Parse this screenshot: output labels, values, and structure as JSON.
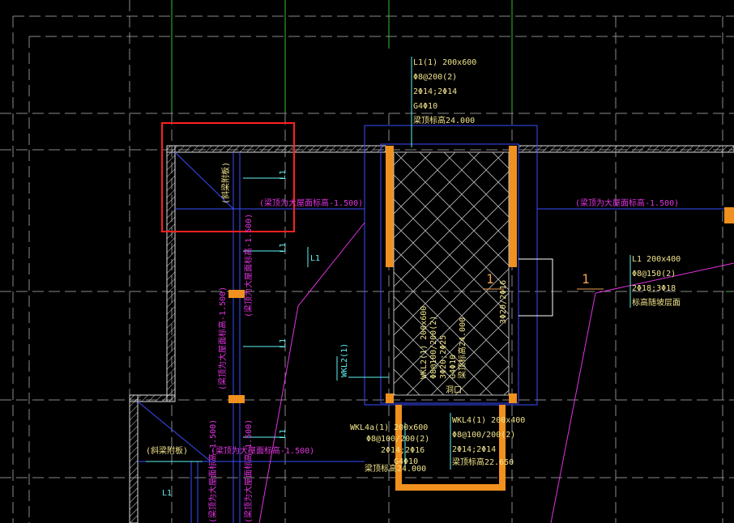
{
  "colors": {
    "background": "#000000",
    "grid_green": "#2fbf2f",
    "beam_blue": "#3a4bff",
    "cyan": "#5ff3f3",
    "magenta": "#e233e2",
    "yellow": "#f0e48a",
    "orange": "#f0901e",
    "selection_red": "#ff2020",
    "hatch_white": "#dddddd"
  },
  "annotations": {
    "top_beam": {
      "name": "L1(1) 200x600",
      "stirrup": "Φ8@200(2)",
      "bars": "2Φ14;2Φ14",
      "side": "G4Φ10",
      "elev": "梁顶标高24.000"
    },
    "right_beam": {
      "name": "L1  200x400",
      "stirrup": "Φ8@150(2)",
      "bars": "2Φ18;3Φ18",
      "elev": "标高随坡层面"
    },
    "wkl2": {
      "name": "WKL2(1) 200x600",
      "stirrup": "Φ8@100/200(2)",
      "bars": "3Φ20;2Φ25",
      "side": "G4Φ10",
      "elev": "梁顶标高24.000"
    },
    "wkl4a": {
      "name": "WKL4a(1) 200x600",
      "stirrup": "Φ8@100/200(2)",
      "bars": "2Φ14;2Φ16",
      "side": "G4Φ10",
      "elev": "梁顶标高24.000"
    },
    "wkl4b": {
      "name": "WKL4(1) 200x400",
      "stirrup": "Φ8@100/200(2)",
      "bars": "2Φ14;2Φ14",
      "elev": "梁顶标高22.650"
    },
    "side_bar_label": "3Φ20/2Φ16",
    "wkl2_short": "WKL2(1)",
    "slab_label_1": "(斜梁附板)",
    "slab_label_2": "(斜梁附板)",
    "note_beam_top_1": "(梁顶为大屋面标高-1.500)",
    "note_beam_top_2": "(梁顶为大屋面标高-1.500)",
    "note_beam_top_3": "(梁顶为大屋面标高-1.500)",
    "note_beam_top_v1": "(梁顶为大屋面标高-1.500)",
    "note_beam_top_v2": "(梁顶为大屋面标高-1.500)",
    "note_beam_top_v3": "(梁顶为大屋面标高-1.500)",
    "note_beam_top_v4": "(梁顶为大屋面标高-1.500)",
    "hole_label": "洞口",
    "L1_a": "L1",
    "L1_b": "L1",
    "L1_c": "L1",
    "L1_d": "L1",
    "L1_e": "L1",
    "L1_f": "L1",
    "section_num_1": "1",
    "section_num_2": "1"
  }
}
